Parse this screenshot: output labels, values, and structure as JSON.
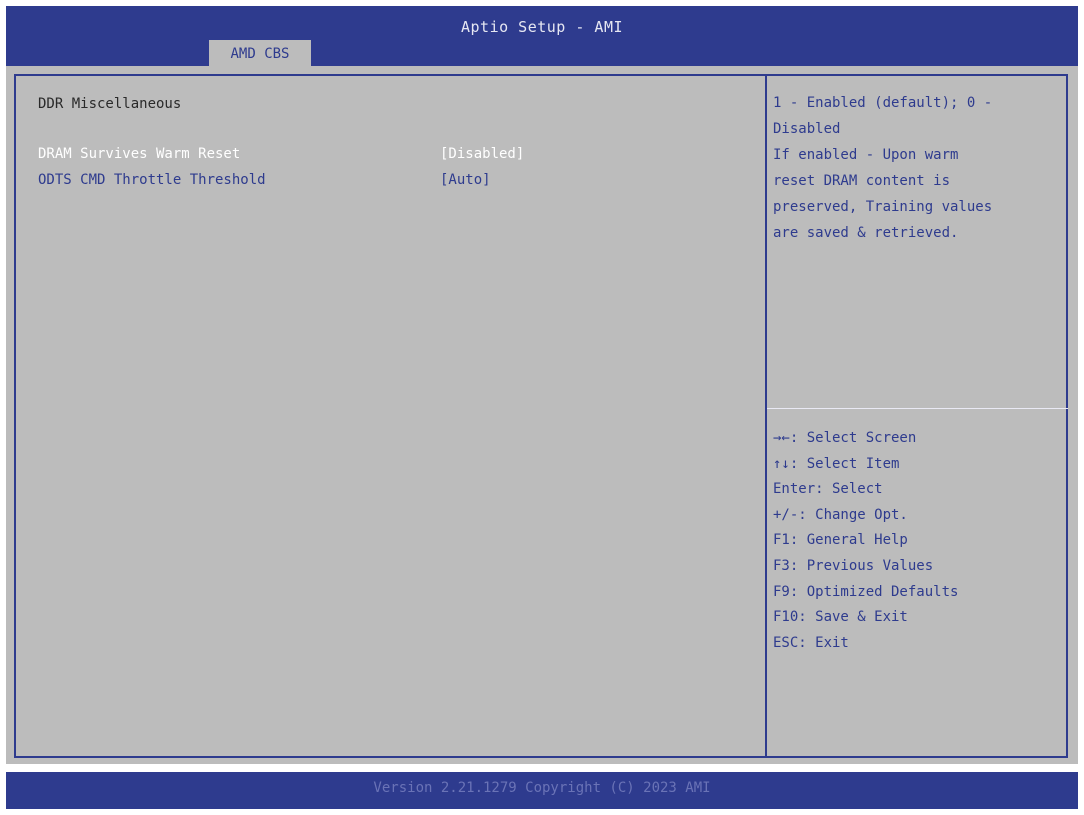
{
  "header": {
    "title": "Aptio Setup - AMI",
    "tabs": [
      {
        "label": "AMD CBS",
        "active": true
      }
    ]
  },
  "main": {
    "section_title": "DDR Miscellaneous",
    "items": [
      {
        "label": "DRAM Survives Warm Reset",
        "value": "[Disabled]",
        "selected": true
      },
      {
        "label": "ODTS CMD Throttle Threshold",
        "value": "[Auto]",
        "selected": false
      }
    ]
  },
  "help": {
    "lines": [
      "1 - Enabled (default); 0 -",
      "Disabled",
      "If enabled - Upon warm",
      "reset DRAM content is",
      "preserved, Training values",
      "are saved & retrieved."
    ]
  },
  "keys": [
    "→←: Select Screen",
    "↑↓: Select Item",
    "Enter: Select",
    "+/-: Change Opt.",
    "F1: General Help",
    "F3: Previous Values",
    "F9: Optimized Defaults",
    "F10: Save & Exit",
    "ESC: Exit"
  ],
  "footer": {
    "text": "Version 2.21.1279 Copyright (C) 2023 AMI"
  },
  "colors": {
    "frame_blue": "#2e3b8e",
    "panel_gray": "#bcbcbc",
    "selected_text": "#ffffff",
    "normal_text": "#2e3b8e"
  }
}
